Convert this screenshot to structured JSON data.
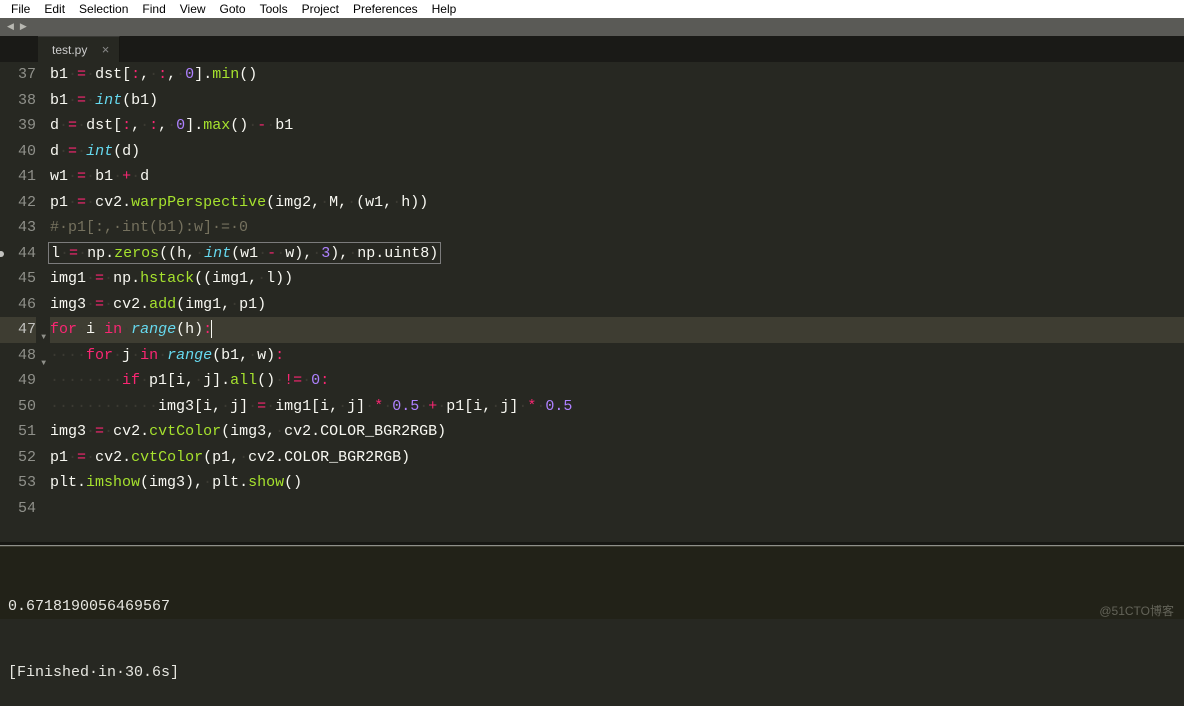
{
  "menu": {
    "items": [
      "File",
      "Edit",
      "Selection",
      "Find",
      "View",
      "Goto",
      "Tools",
      "Project",
      "Preferences",
      "Help"
    ]
  },
  "tab": {
    "name": "test.py",
    "close": "×"
  },
  "nav": {
    "left": "◀",
    "right": "▶"
  },
  "lines": [
    {
      "n": 37,
      "modified": false,
      "fold": "",
      "hl": false,
      "boxed": false,
      "segs": [
        {
          "t": "b1",
          "c": "var"
        },
        {
          "t": "·",
          "c": "dot"
        },
        {
          "t": "=",
          "c": "op"
        },
        {
          "t": "·",
          "c": "dot"
        },
        {
          "t": "dst[",
          "c": "var"
        },
        {
          "t": ":",
          "c": "op"
        },
        {
          "t": ",",
          "c": "var"
        },
        {
          "t": "·",
          "c": "dot"
        },
        {
          "t": ":",
          "c": "op"
        },
        {
          "t": ",",
          "c": "var"
        },
        {
          "t": "·",
          "c": "dot"
        },
        {
          "t": "0",
          "c": "num"
        },
        {
          "t": "].",
          "c": "var"
        },
        {
          "t": "min",
          "c": "func"
        },
        {
          "t": "()",
          "c": "var"
        }
      ]
    },
    {
      "n": 38,
      "modified": false,
      "fold": "",
      "hl": false,
      "boxed": false,
      "segs": [
        {
          "t": "b1",
          "c": "var"
        },
        {
          "t": "·",
          "c": "dot"
        },
        {
          "t": "=",
          "c": "op"
        },
        {
          "t": "·",
          "c": "dot"
        },
        {
          "t": "int",
          "c": "builtin"
        },
        {
          "t": "(b1)",
          "c": "var"
        }
      ]
    },
    {
      "n": 39,
      "modified": false,
      "fold": "",
      "hl": false,
      "boxed": false,
      "segs": [
        {
          "t": "d",
          "c": "var"
        },
        {
          "t": "·",
          "c": "dot"
        },
        {
          "t": "=",
          "c": "op"
        },
        {
          "t": "·",
          "c": "dot"
        },
        {
          "t": "dst[",
          "c": "var"
        },
        {
          "t": ":",
          "c": "op"
        },
        {
          "t": ",",
          "c": "var"
        },
        {
          "t": "·",
          "c": "dot"
        },
        {
          "t": ":",
          "c": "op"
        },
        {
          "t": ",",
          "c": "var"
        },
        {
          "t": "·",
          "c": "dot"
        },
        {
          "t": "0",
          "c": "num"
        },
        {
          "t": "].",
          "c": "var"
        },
        {
          "t": "max",
          "c": "func"
        },
        {
          "t": "()",
          "c": "var"
        },
        {
          "t": "·",
          "c": "dot"
        },
        {
          "t": "-",
          "c": "op"
        },
        {
          "t": "·",
          "c": "dot"
        },
        {
          "t": "b1",
          "c": "var"
        }
      ]
    },
    {
      "n": 40,
      "modified": false,
      "fold": "",
      "hl": false,
      "boxed": false,
      "segs": [
        {
          "t": "d",
          "c": "var"
        },
        {
          "t": "·",
          "c": "dot"
        },
        {
          "t": "=",
          "c": "op"
        },
        {
          "t": "·",
          "c": "dot"
        },
        {
          "t": "int",
          "c": "builtin"
        },
        {
          "t": "(d)",
          "c": "var"
        }
      ]
    },
    {
      "n": 41,
      "modified": false,
      "fold": "",
      "hl": false,
      "boxed": false,
      "segs": [
        {
          "t": "w1",
          "c": "var"
        },
        {
          "t": "·",
          "c": "dot"
        },
        {
          "t": "=",
          "c": "op"
        },
        {
          "t": "·",
          "c": "dot"
        },
        {
          "t": "b1",
          "c": "var"
        },
        {
          "t": "·",
          "c": "dot"
        },
        {
          "t": "+",
          "c": "op"
        },
        {
          "t": "·",
          "c": "dot"
        },
        {
          "t": "d",
          "c": "var"
        }
      ]
    },
    {
      "n": 42,
      "modified": false,
      "fold": "",
      "hl": false,
      "boxed": false,
      "segs": [
        {
          "t": "p1",
          "c": "var"
        },
        {
          "t": "·",
          "c": "dot"
        },
        {
          "t": "=",
          "c": "op"
        },
        {
          "t": "·",
          "c": "dot"
        },
        {
          "t": "cv2.",
          "c": "var"
        },
        {
          "t": "warpPerspective",
          "c": "func"
        },
        {
          "t": "(img2,",
          "c": "var"
        },
        {
          "t": "·",
          "c": "dot"
        },
        {
          "t": "M,",
          "c": "var"
        },
        {
          "t": "·",
          "c": "dot"
        },
        {
          "t": "(w1,",
          "c": "var"
        },
        {
          "t": "·",
          "c": "dot"
        },
        {
          "t": "h))",
          "c": "var"
        }
      ]
    },
    {
      "n": 43,
      "modified": false,
      "fold": "",
      "hl": false,
      "boxed": false,
      "segs": [
        {
          "t": "#·p1[:,·int(b1):w]·=·0",
          "c": "comment"
        }
      ]
    },
    {
      "n": 44,
      "modified": true,
      "fold": "",
      "hl": false,
      "boxed": true,
      "segs": [
        {
          "t": "l",
          "c": "var"
        },
        {
          "t": "·",
          "c": "dot"
        },
        {
          "t": "=",
          "c": "op"
        },
        {
          "t": "·",
          "c": "dot"
        },
        {
          "t": "np.",
          "c": "var"
        },
        {
          "t": "zeros",
          "c": "func"
        },
        {
          "t": "((h,",
          "c": "var"
        },
        {
          "t": "·",
          "c": "dot"
        },
        {
          "t": "int",
          "c": "builtin"
        },
        {
          "t": "(w1",
          "c": "var"
        },
        {
          "t": "·",
          "c": "dot"
        },
        {
          "t": "-",
          "c": "op"
        },
        {
          "t": "·",
          "c": "dot"
        },
        {
          "t": "w),",
          "c": "var"
        },
        {
          "t": "·",
          "c": "dot"
        },
        {
          "t": "3",
          "c": "num"
        },
        {
          "t": "),",
          "c": "var"
        },
        {
          "t": "·",
          "c": "dot"
        },
        {
          "t": "np.uint8)",
          "c": "var"
        }
      ]
    },
    {
      "n": 45,
      "modified": false,
      "fold": "",
      "hl": false,
      "boxed": false,
      "segs": [
        {
          "t": "img1",
          "c": "var"
        },
        {
          "t": "·",
          "c": "dot"
        },
        {
          "t": "=",
          "c": "op"
        },
        {
          "t": "·",
          "c": "dot"
        },
        {
          "t": "np.",
          "c": "var"
        },
        {
          "t": "hstack",
          "c": "func"
        },
        {
          "t": "((img1,",
          "c": "var"
        },
        {
          "t": "·",
          "c": "dot"
        },
        {
          "t": "l))",
          "c": "var"
        }
      ]
    },
    {
      "n": 46,
      "modified": false,
      "fold": "",
      "hl": false,
      "boxed": false,
      "segs": [
        {
          "t": "img3",
          "c": "var"
        },
        {
          "t": "·",
          "c": "dot"
        },
        {
          "t": "=",
          "c": "op"
        },
        {
          "t": "·",
          "c": "dot"
        },
        {
          "t": "cv2.",
          "c": "var"
        },
        {
          "t": "add",
          "c": "func"
        },
        {
          "t": "(img1,",
          "c": "var"
        },
        {
          "t": "·",
          "c": "dot"
        },
        {
          "t": "p1)",
          "c": "var"
        }
      ]
    },
    {
      "n": 47,
      "modified": false,
      "fold": "▼",
      "hl": true,
      "boxed": false,
      "cursor": true,
      "segs": [
        {
          "t": "for",
          "c": "kw"
        },
        {
          "t": "·",
          "c": "dot"
        },
        {
          "t": "i",
          "c": "var"
        },
        {
          "t": "·",
          "c": "dot"
        },
        {
          "t": "in",
          "c": "kw"
        },
        {
          "t": "·",
          "c": "dot"
        },
        {
          "t": "range",
          "c": "builtin"
        },
        {
          "t": "(h)",
          "c": "var"
        },
        {
          "t": ":",
          "c": "op"
        }
      ]
    },
    {
      "n": 48,
      "modified": false,
      "fold": "▼",
      "hl": false,
      "boxed": false,
      "segs": [
        {
          "t": "····",
          "c": "dot"
        },
        {
          "t": "for",
          "c": "kw"
        },
        {
          "t": "·",
          "c": "dot"
        },
        {
          "t": "j",
          "c": "var"
        },
        {
          "t": "·",
          "c": "dot"
        },
        {
          "t": "in",
          "c": "kw"
        },
        {
          "t": "·",
          "c": "dot"
        },
        {
          "t": "range",
          "c": "builtin"
        },
        {
          "t": "(b1,",
          "c": "var"
        },
        {
          "t": "·",
          "c": "dot"
        },
        {
          "t": "w)",
          "c": "var"
        },
        {
          "t": ":",
          "c": "op"
        }
      ]
    },
    {
      "n": 49,
      "modified": false,
      "fold": "",
      "hl": false,
      "boxed": false,
      "segs": [
        {
          "t": "········",
          "c": "dot"
        },
        {
          "t": "if",
          "c": "kw"
        },
        {
          "t": "·",
          "c": "dot"
        },
        {
          "t": "p1[i,",
          "c": "var"
        },
        {
          "t": "·",
          "c": "dot"
        },
        {
          "t": "j].",
          "c": "var"
        },
        {
          "t": "all",
          "c": "func"
        },
        {
          "t": "()",
          "c": "var"
        },
        {
          "t": "·",
          "c": "dot"
        },
        {
          "t": "!=",
          "c": "op"
        },
        {
          "t": "·",
          "c": "dot"
        },
        {
          "t": "0",
          "c": "num"
        },
        {
          "t": ":",
          "c": "op"
        }
      ]
    },
    {
      "n": 50,
      "modified": false,
      "fold": "",
      "hl": false,
      "boxed": false,
      "segs": [
        {
          "t": "············",
          "c": "dot"
        },
        {
          "t": "img3[i,",
          "c": "var"
        },
        {
          "t": "·",
          "c": "dot"
        },
        {
          "t": "j]",
          "c": "var"
        },
        {
          "t": "·",
          "c": "dot"
        },
        {
          "t": "=",
          "c": "op"
        },
        {
          "t": "·",
          "c": "dot"
        },
        {
          "t": "img1[i,",
          "c": "var"
        },
        {
          "t": "·",
          "c": "dot"
        },
        {
          "t": "j]",
          "c": "var"
        },
        {
          "t": "·",
          "c": "dot"
        },
        {
          "t": "*",
          "c": "op"
        },
        {
          "t": "·",
          "c": "dot"
        },
        {
          "t": "0.5",
          "c": "num"
        },
        {
          "t": "·",
          "c": "dot"
        },
        {
          "t": "+",
          "c": "op"
        },
        {
          "t": "·",
          "c": "dot"
        },
        {
          "t": "p1[i,",
          "c": "var"
        },
        {
          "t": "·",
          "c": "dot"
        },
        {
          "t": "j]",
          "c": "var"
        },
        {
          "t": "·",
          "c": "dot"
        },
        {
          "t": "*",
          "c": "op"
        },
        {
          "t": "·",
          "c": "dot"
        },
        {
          "t": "0.5",
          "c": "num"
        }
      ]
    },
    {
      "n": 51,
      "modified": false,
      "fold": "",
      "hl": false,
      "boxed": false,
      "segs": [
        {
          "t": "img3",
          "c": "var"
        },
        {
          "t": "·",
          "c": "dot"
        },
        {
          "t": "=",
          "c": "op"
        },
        {
          "t": "·",
          "c": "dot"
        },
        {
          "t": "cv2.",
          "c": "var"
        },
        {
          "t": "cvtColor",
          "c": "func"
        },
        {
          "t": "(img3,",
          "c": "var"
        },
        {
          "t": "·",
          "c": "dot"
        },
        {
          "t": "cv2.COLOR_BGR2RGB)",
          "c": "var"
        }
      ]
    },
    {
      "n": 52,
      "modified": false,
      "fold": "",
      "hl": false,
      "boxed": false,
      "segs": [
        {
          "t": "p1",
          "c": "var"
        },
        {
          "t": "·",
          "c": "dot"
        },
        {
          "t": "=",
          "c": "op"
        },
        {
          "t": "·",
          "c": "dot"
        },
        {
          "t": "cv2.",
          "c": "var"
        },
        {
          "t": "cvtColor",
          "c": "func"
        },
        {
          "t": "(p1,",
          "c": "var"
        },
        {
          "t": "·",
          "c": "dot"
        },
        {
          "t": "cv2.COLOR_BGR2RGB)",
          "c": "var"
        }
      ]
    },
    {
      "n": 53,
      "modified": false,
      "fold": "",
      "hl": false,
      "boxed": false,
      "segs": [
        {
          "t": "plt.",
          "c": "var"
        },
        {
          "t": "imshow",
          "c": "func"
        },
        {
          "t": "(img3),",
          "c": "var"
        },
        {
          "t": "·",
          "c": "dot"
        },
        {
          "t": "plt.",
          "c": "var"
        },
        {
          "t": "show",
          "c": "func"
        },
        {
          "t": "()",
          "c": "var"
        }
      ]
    },
    {
      "n": 54,
      "modified": false,
      "fold": "",
      "hl": false,
      "boxed": false,
      "segs": []
    }
  ],
  "console": {
    "line1": "0.6718190056469567",
    "line2": "[Finished·in·30.6s]"
  },
  "watermark": "@51CTO博客"
}
